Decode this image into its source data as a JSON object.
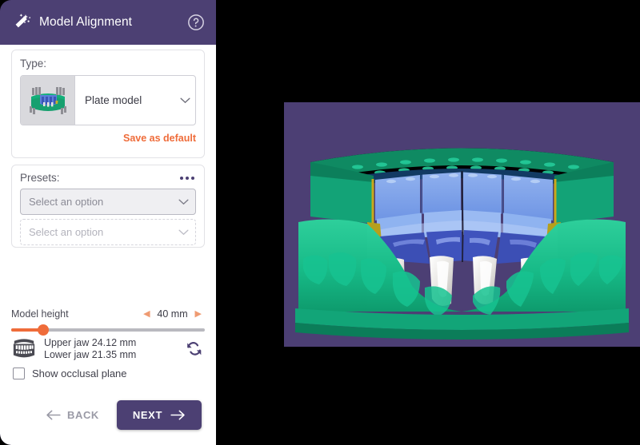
{
  "header": {
    "title": "Model Alignment",
    "wand_icon": "magic-wand-icon",
    "help_icon": "help-circle-icon",
    "bg_color": "#4c4073"
  },
  "type_section": {
    "label": "Type:",
    "selected": "Plate model",
    "thumbnail_alt": "plate-model-thumbnail",
    "caret_icon": "chevron-down-icon",
    "save_default_label": "Save as default",
    "save_default_color": "#ef6c3a"
  },
  "presets_section": {
    "label": "Presets:",
    "more_icon": "ellipsis-icon",
    "primary_select": {
      "placeholder": "Select an option",
      "value": "Select an option",
      "caret_icon": "chevron-down-icon"
    },
    "secondary_select": {
      "placeholder": "Select an option",
      "value": "Select an option",
      "caret_icon": "chevron-down-icon"
    }
  },
  "model_height": {
    "label": "Model height",
    "value": "40 mm",
    "decrement_icon": "triangle-left-icon",
    "increment_icon": "triangle-right-icon",
    "slider_percent": 15,
    "accent_color": "#ef6c3a"
  },
  "jaw_info": {
    "icon": "dental-arch-icon",
    "upper": "Upper jaw 24.12 mm",
    "lower": "Lower jaw 21.35 mm",
    "recalculate_icon": "refresh-icon"
  },
  "occlusal": {
    "label": "Show occlusal plane",
    "checked": false
  },
  "footer": {
    "back_label": "BACK",
    "back_icon": "arrow-left-icon",
    "next_label": "NEXT",
    "next_icon": "arrow-right-icon",
    "next_bg": "#4c4073"
  },
  "viewport": {
    "background_color": "#4c3f74",
    "model_name": "dental-plate-model-3d"
  }
}
